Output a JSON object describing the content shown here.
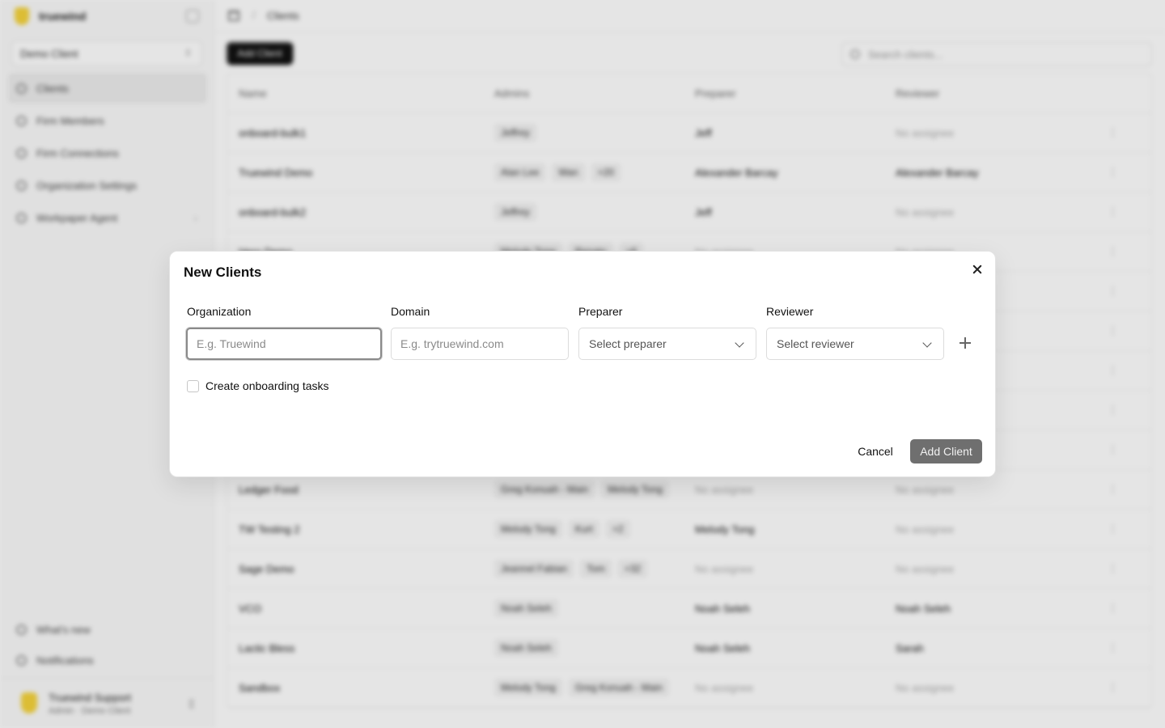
{
  "sidebar": {
    "brand": "truewind",
    "client_selector": "Demo Client",
    "nav": [
      {
        "label": "Clients"
      },
      {
        "label": "Firm Members"
      },
      {
        "label": "Firm Connections"
      },
      {
        "label": "Organization Settings"
      },
      {
        "label": "Workpaper Agent"
      }
    ],
    "bottom": [
      {
        "label": "What's new"
      },
      {
        "label": "Notifications"
      }
    ],
    "user": {
      "name": "Truewind Support",
      "subtitle": "Admin · Demo Client"
    }
  },
  "header": {
    "breadcrumb": "Clients",
    "add_button": "Add Client",
    "search_placeholder": "Search clients..."
  },
  "table": {
    "columns": [
      "Name",
      "Admins",
      "Preparer",
      "Reviewer"
    ],
    "rows": [
      {
        "name": "onboard-bulk1",
        "admins": [
          "Jeffrey"
        ],
        "preparer": "Jeff",
        "reviewer": "No assignee"
      },
      {
        "name": "Truewind Demo",
        "admins": [
          "Alan Lee",
          "Wan",
          "+20"
        ],
        "preparer": "Alexander Barcay",
        "reviewer": "Alexander Barcay"
      },
      {
        "name": "onboard-bulk2",
        "admins": [
          "Jeffrey"
        ],
        "preparer": "Jeff",
        "reviewer": "No assignee"
      },
      {
        "name": "Hero Demo",
        "admins": [
          "Melody Tong",
          "Renato",
          "+6"
        ],
        "preparer": "No assignee",
        "reviewer": "No assignee"
      },
      {
        "name": "",
        "admins": [],
        "preparer": "",
        "reviewer": ""
      },
      {
        "name": "",
        "admins": [],
        "preparer": "",
        "reviewer": ""
      },
      {
        "name": "",
        "admins": [],
        "preparer": "",
        "reviewer": ""
      },
      {
        "name": "",
        "admins": [],
        "preparer": "",
        "reviewer": ""
      },
      {
        "name": "",
        "admins": [],
        "preparer": "",
        "reviewer": ""
      },
      {
        "name": "Ledger Food",
        "admins": [
          "Greg Konuah - Main",
          "Melody Tong"
        ],
        "preparer": "No assignee",
        "reviewer": "No assignee"
      },
      {
        "name": "TW Testing 2",
        "admins": [
          "Melody Tong",
          "Kurt",
          "+2"
        ],
        "preparer": "Melody Tong",
        "reviewer": "No assignee"
      },
      {
        "name": "Sage Demo",
        "admins": [
          "Jeannel Fabian",
          "Tom",
          "+32"
        ],
        "preparer": "No assignee",
        "reviewer": "No assignee"
      },
      {
        "name": "VCO",
        "admins": [
          "Noah Seleh"
        ],
        "preparer": "Noah Seleh",
        "reviewer": "Noah Seleh"
      },
      {
        "name": "Lactic Bless",
        "admins": [
          "Noah Seleh"
        ],
        "preparer": "Noah Seleh",
        "reviewer": "Sarah"
      },
      {
        "name": "Sandbox",
        "admins": [
          "Melody Tong",
          "Greg Konuah - Main"
        ],
        "preparer": "No assignee",
        "reviewer": "No assignee"
      }
    ]
  },
  "modal": {
    "title": "New Clients",
    "organization": {
      "label": "Organization",
      "placeholder": "E.g. Truewind",
      "value": ""
    },
    "domain": {
      "label": "Domain",
      "placeholder": "E.g. trytruewind.com",
      "value": ""
    },
    "preparer": {
      "label": "Preparer",
      "placeholder": "Select preparer"
    },
    "reviewer": {
      "label": "Reviewer",
      "placeholder": "Select reviewer"
    },
    "onboarding_checkbox": {
      "label": "Create onboarding tasks",
      "checked": false
    },
    "cancel_label": "Cancel",
    "submit_label": "Add Client"
  },
  "colors": {
    "brand_yellow": "#f5d33b",
    "primary_disabled": "#6f6f6f",
    "overlay": "rgba(0,0,0,0.10)"
  }
}
